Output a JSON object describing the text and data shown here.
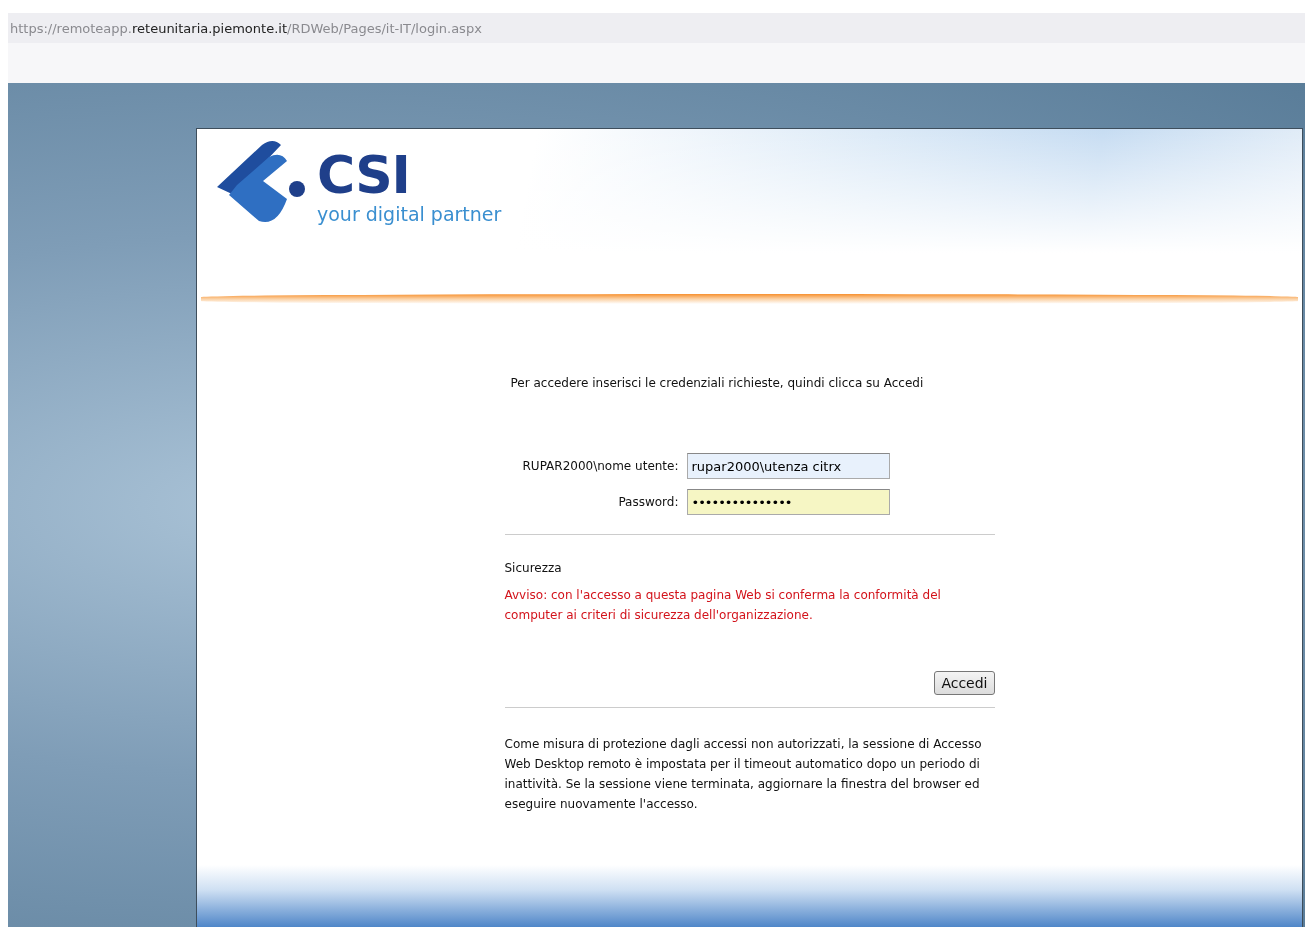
{
  "address_bar": {
    "url_prefix": "https://remoteapp.",
    "url_host": "reteunitaria.piemonte.it",
    "url_path": "/RDWeb/Pages/it-IT/login.aspx"
  },
  "logo": {
    "name": "CSI",
    "tagline": "your digital partner"
  },
  "login": {
    "instruction": "Per accedere inserisci le credenziali richieste, quindi clicca su Accedi",
    "fields": [
      {
        "label": "RUPAR2000\\nome utente:",
        "value": "rupar2000\\utenza citrx",
        "kind": "text"
      },
      {
        "label": "Password:",
        "value": "•••••••••••••••",
        "kind": "password"
      }
    ],
    "security_title": "Sicurezza",
    "warning": "Avviso: con l'accesso a questa pagina Web si conferma la conformità del computer ai criteri di sicurezza dell'organizzazione.",
    "submit": "Accedi",
    "notice": "Come misura di protezione dagli accessi non autorizzati, la sessione di Accesso Web Desktop remoto è impostata per il timeout automatico dopo un periodo di inattività. Se la sessione viene terminata, aggiornare la finestra del browser ed eseguire nuovamente l'accesso."
  }
}
